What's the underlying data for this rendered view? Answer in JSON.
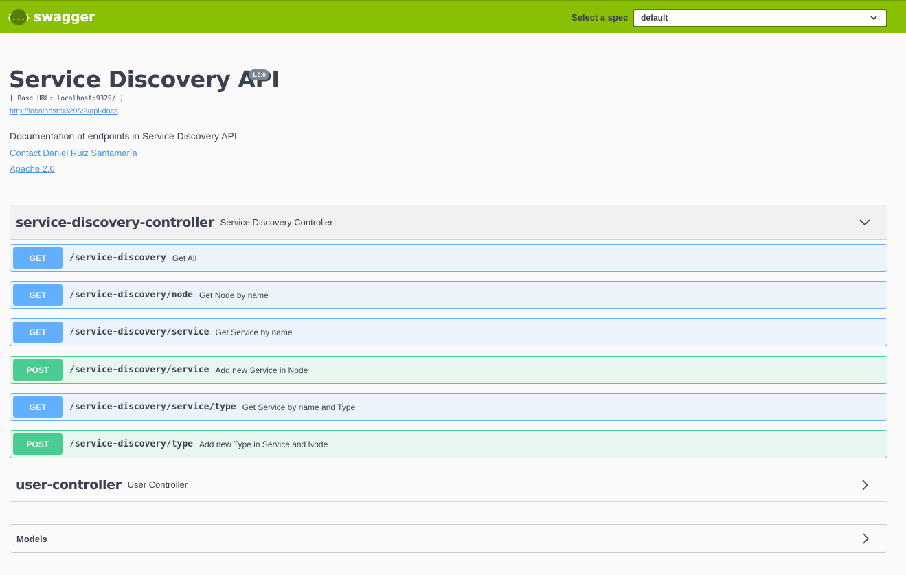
{
  "topbar": {
    "logo_icon": "{...}",
    "logo_text": "swagger",
    "spec_label": "Select a spec",
    "spec_value": "default",
    "color": "#89bf04"
  },
  "info": {
    "title": "Service Discovery API",
    "version": "1.0.0",
    "base_url": "[ Base URL: localhost:9329/ ]",
    "docs_url": "http://localhost:9329/v2/api-docs",
    "description": "Documentation of endpoints in Service Discovery API",
    "contact": "Contact Daniel Ruiz Santamaría",
    "license": "Apache 2.0"
  },
  "tags": [
    {
      "name": "service-discovery-controller",
      "description": "Service Discovery Controller",
      "expanded": true,
      "operations": [
        {
          "method": "GET",
          "path": "/service-discovery",
          "summary": "Get All"
        },
        {
          "method": "GET",
          "path": "/service-discovery/node",
          "summary": "Get Node by name"
        },
        {
          "method": "GET",
          "path": "/service-discovery/service",
          "summary": "Get Service by name"
        },
        {
          "method": "POST",
          "path": "/service-discovery/service",
          "summary": "Add new Service in Node"
        },
        {
          "method": "GET",
          "path": "/service-discovery/service/type",
          "summary": "Get Service by name and Type"
        },
        {
          "method": "POST",
          "path": "/service-discovery/type",
          "summary": "Add new Type in Service and Node"
        }
      ]
    },
    {
      "name": "user-controller",
      "description": "User Controller",
      "expanded": false
    }
  ],
  "models": {
    "label": "Models"
  },
  "colors": {
    "get": "#61affe",
    "post": "#49cc90",
    "link": "#4990e2"
  }
}
